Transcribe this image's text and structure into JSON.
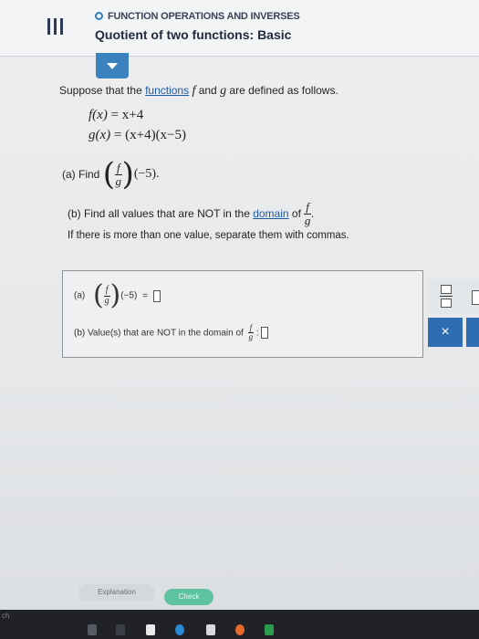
{
  "header": {
    "topic": "FUNCTION OPERATIONS AND INVERSES",
    "lesson": "Quotient of two functions: Basic"
  },
  "problem": {
    "intro_prefix": "Suppose that the ",
    "intro_link": "functions",
    "intro_f": "f",
    "intro_and": "and",
    "intro_g": "g",
    "intro_suffix": "are defined as follows.",
    "f_def_lhs": "f(x)",
    "f_def_rhs": " = x+4",
    "g_def_lhs": "g(x)",
    "g_def_rhs": " = (x+4)(x−5)",
    "part_a_label": "(a) Find",
    "part_a_arg": "(−5).",
    "part_b_prefix": "(b) Find all values that are NOT in the ",
    "part_b_link": "domain",
    "part_b_of": " of",
    "part_b_note": "If there is more than one value, separate them with commas."
  },
  "fraction": {
    "num": "f",
    "den": "g"
  },
  "answer": {
    "a_label": "(a)",
    "a_arg": "(−5)",
    "a_eq": "=",
    "b_text": "(b)  Value(s) that are NOT in the domain of",
    "b_colon": ":"
  },
  "buttons": {
    "close": "×",
    "explanation": "Explanation",
    "check": "Check"
  },
  "taskbar": {
    "text": "ch"
  }
}
